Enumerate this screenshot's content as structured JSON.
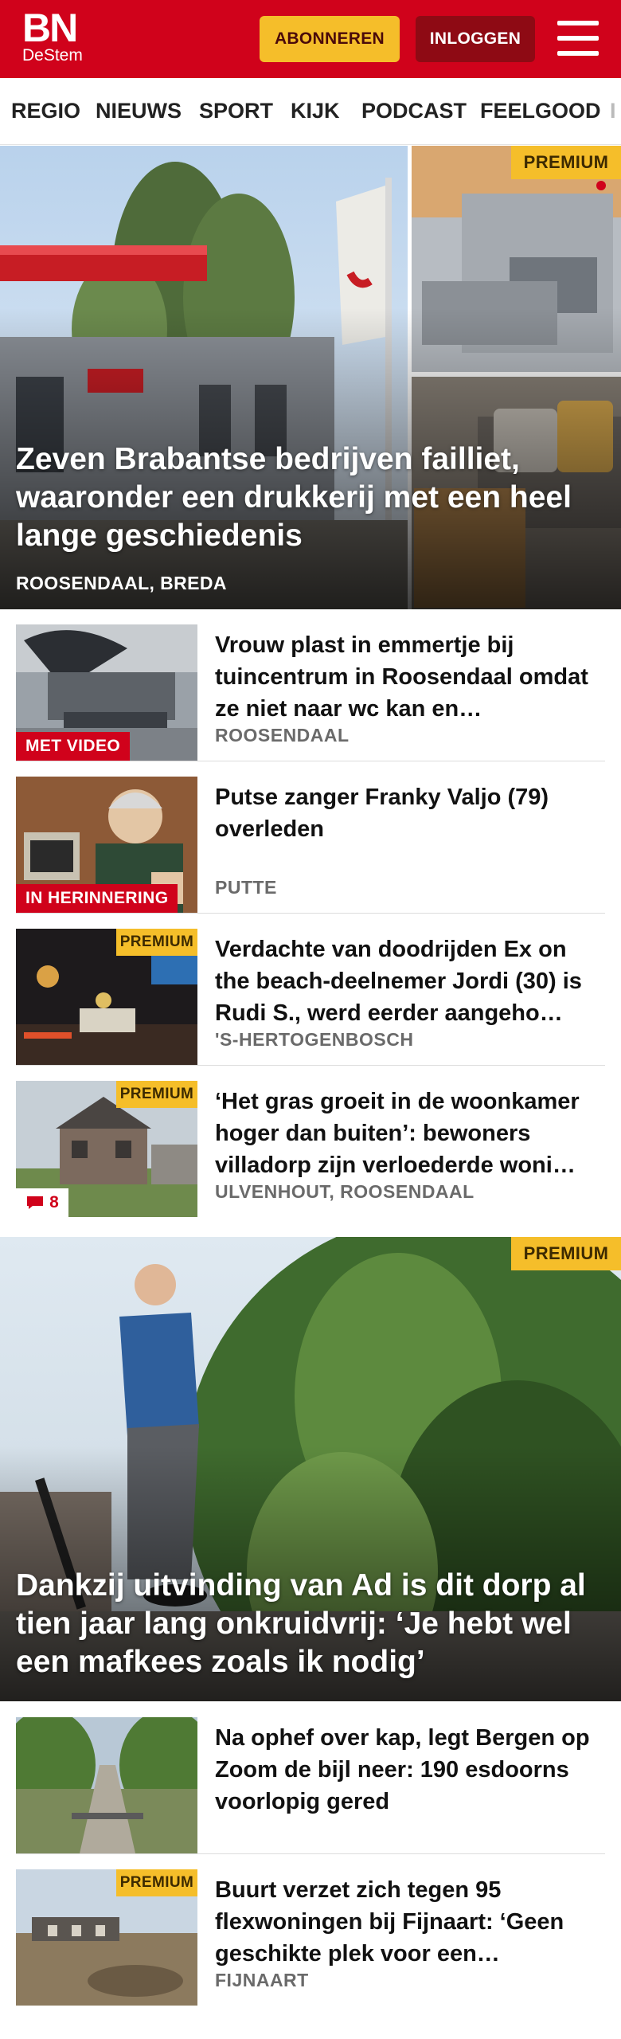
{
  "header": {
    "logo_main": "BN",
    "logo_sub": "DeStem",
    "subscribe_label": "ABONNEREN",
    "login_label": "INLOGGEN",
    "menu_icon": "hamburger-menu-icon"
  },
  "nav": {
    "items": [
      "REGIO",
      "NIEUWS",
      "SPORT",
      "KIJK",
      "PODCAST",
      "FEELGOOD",
      "I"
    ]
  },
  "premium_label": "PREMIUM",
  "hero1": {
    "title": "Zeven Brabantse bedrijven failliet, waaronder een drukkerij met een heel lange geschiedenis",
    "location": "ROOSENDAAL, BREDA"
  },
  "articles": [
    {
      "title": "Vrouw plast in emmertje bij tuincentrum in Roosendaal omdat ze niet naar wc kan en…",
      "location": "ROOSENDAAL",
      "tag": "MET VIDEO"
    },
    {
      "title": "Putse zanger Franky Valjo (79) overleden",
      "location": "PUTTE",
      "tag": "IN HERINNERING"
    },
    {
      "title": "Verdachte van doodrijden Ex on the beach-deelnemer Jordi (30) is Rudi S., werd eerder aangeho…",
      "location": "'S-HERTOGENBOSCH",
      "premium": true
    },
    {
      "title": "‘Het gras groeit in de woonkamer hoger dan buiten’: bewoners villadorp zijn verloederde woni…",
      "location": "ULVENHOUT, ROOSENDAAL",
      "premium": true,
      "comments": "8"
    }
  ],
  "hero2": {
    "title": "Dankzij uitvinding van Ad is dit dorp al tien jaar lang onkruidvrij: ‘Je hebt wel een mafkees zoals ik nodig’"
  },
  "articles2": [
    {
      "title": "Na ophef over kap, legt Bergen op Zoom de bijl neer: 190 esdoorns voorlopig gered",
      "location": ""
    },
    {
      "title": "Buurt verzet zich tegen 95 flexwoningen bij Fijnaart: ‘Geen geschikte plek voor een…",
      "location": "FIJNAART",
      "premium": true
    }
  ],
  "colors": {
    "brand_red": "#d0021b",
    "premium_yellow": "#f5be2a",
    "login_dark_red": "#8e0a14"
  }
}
